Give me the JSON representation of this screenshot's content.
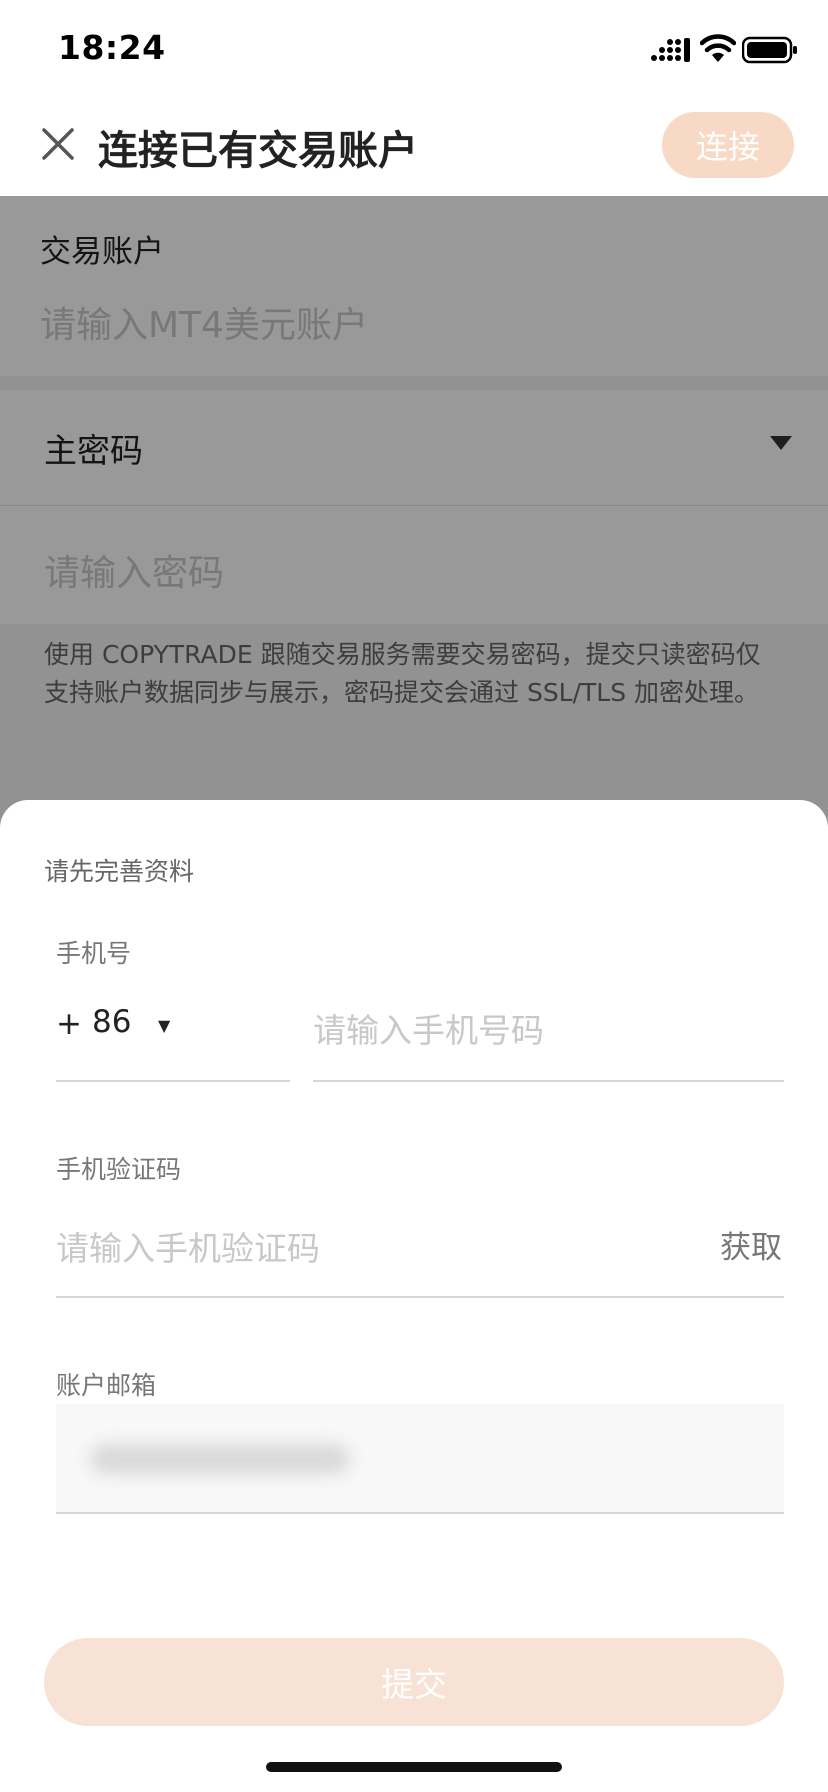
{
  "status_bar": {
    "time": "18:24"
  },
  "nav": {
    "title": "连接已有交易账户",
    "connect_label": "连接"
  },
  "form": {
    "account_label": "交易账户",
    "account_placeholder": "请输入MT4美元账户",
    "password_type": "主密码",
    "password_placeholder": "请输入密码",
    "hint": "使用 COPYTRADE 跟随交易服务需要交易密码，提交只读密码仅支持账户数据同步与展示，密码提交会通过 SSL/TLS 加密处理。"
  },
  "sheet": {
    "title": "请先完善资料",
    "phone_label": "手机号",
    "country_code_prefix": "+",
    "country_code": "86",
    "phone_placeholder": "请输入手机号码",
    "code_label": "手机验证码",
    "code_placeholder": "请输入手机验证码",
    "get_code_label": "获取",
    "email_label": "账户邮箱",
    "submit_label": "提交"
  },
  "colors": {
    "accent_disabled": "#f7d9c5",
    "overlay": "rgba(0,0,0,0.40)"
  },
  "icons": {
    "close": "close-icon",
    "signal": "cellular-signal-icon",
    "wifi": "wifi-icon",
    "battery": "battery-icon",
    "dropdown": "caret-down-icon"
  }
}
